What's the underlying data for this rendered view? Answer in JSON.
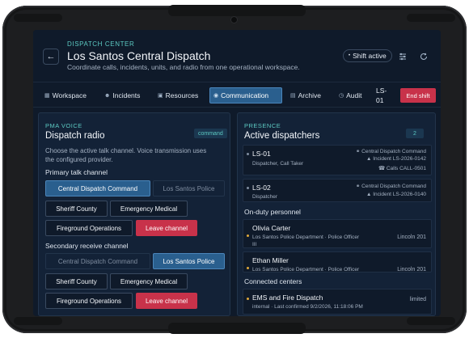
{
  "header": {
    "eyebrow": "DISPATCH CENTER",
    "title": "Los Santos Central Dispatch",
    "subtitle": "Coordinate calls, incidents, units, and radio from one operational workspace.",
    "shift_label": "Shift active"
  },
  "tabs": [
    {
      "label": "Workspace",
      "icon": "grid-icon"
    },
    {
      "label": "Incidents",
      "icon": "people-icon"
    },
    {
      "label": "Resources",
      "icon": "car-icon"
    },
    {
      "label": "Communication",
      "icon": "radio-icon"
    },
    {
      "label": "Archive",
      "icon": "archive-icon"
    },
    {
      "label": "Audit",
      "icon": "clock-icon"
    }
  ],
  "incident_short": "LS-",
  "incident_short2": "01",
  "end_shift_label": "End shift",
  "radio": {
    "eyebrow": "PMA VOICE",
    "title": "Dispatch radio",
    "badge": "command",
    "description": "Choose the active talk channel. Voice transmission uses the configured provider.",
    "primary_label": "Primary talk channel",
    "secondary_label": "Secondary receive channel",
    "primary": [
      "Central Dispatch Command",
      "Los Santos Police",
      "Sheriff County",
      "Emergency Medical",
      "Fireground Operations",
      "Leave channel"
    ],
    "secondary": [
      "Central Dispatch Command",
      "Los Santos Police",
      "Sheriff County",
      "Emergency Medical",
      "Fireground Operations",
      "Leave channel"
    ]
  },
  "presence": {
    "eyebrow": "PRESENCE",
    "title": "Active dispatchers",
    "count": "2",
    "dispatchers": [
      {
        "id": "LS-01",
        "role": "Dispatcher, Call Taker",
        "channel": "Central Dispatch Command",
        "incident": "Incident LS-2026-0142",
        "calls": "Calls CALL-0501"
      },
      {
        "id": "LS-02",
        "role": "Dispatcher",
        "channel": "Central Dispatch Command",
        "incident": "Incident LS-2026-0140"
      }
    ],
    "on_duty_label": "On-duty personnel",
    "personnel": [
      {
        "name": "Olivia Carter",
        "dept": "Los Santos Police Department · Police Officer",
        "rank": "III",
        "unit": "Lincoln 201"
      },
      {
        "name": "Ethan Miller",
        "dept": "Los Santos Police Department · Police Officer",
        "unit": "Lincoln 201"
      }
    ],
    "centers_label": "Connected centers",
    "centers": [
      {
        "name": "EMS and Fire Dispatch",
        "detail": "internal · Last confirmed 9/2/2026, 11:18:06 PM",
        "status": "limited"
      }
    ]
  }
}
